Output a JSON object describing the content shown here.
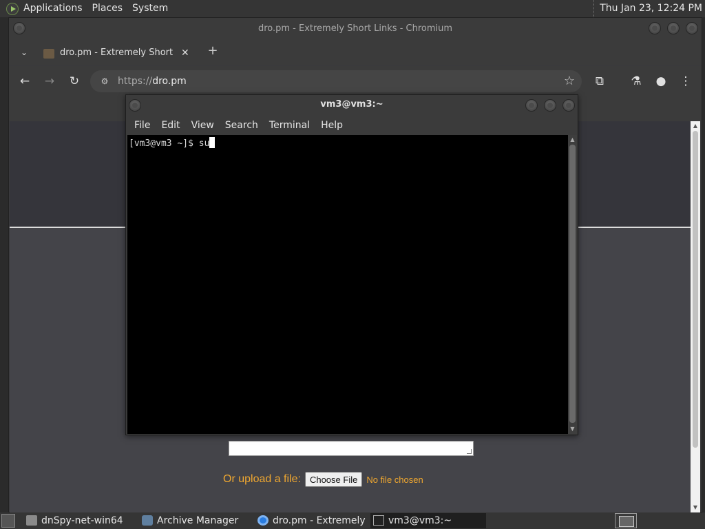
{
  "top_panel": {
    "menus": [
      "Applications",
      "Places",
      "System"
    ],
    "clock": "Thu Jan 23, 12:24 PM"
  },
  "browser": {
    "window_title": "dro.pm - Extremely Short Links - Chromium",
    "tab": {
      "title": "dro.pm - Extremely Short Links",
      "close_glyph": "✕"
    },
    "new_tab_glyph": "+",
    "tab_list_glyph": "⌄",
    "url_scheme": "https://",
    "url_host": "dro.pm",
    "buttons": {
      "back": "←",
      "forward": "→",
      "reload": "↻",
      "star": "☆",
      "extensions": "⧉",
      "labs": "⚗",
      "profile": "●",
      "menu": "⋮"
    }
  },
  "page": {
    "upload_label": "Or upload a file:",
    "choose_file": "Choose File",
    "no_file": "No file chosen"
  },
  "terminal": {
    "title": "vm3@vm3:~",
    "menus": [
      "File",
      "Edit",
      "View",
      "Search",
      "Terminal",
      "Help"
    ],
    "line": "[vm3@vm3 ~]$ su"
  },
  "taskbar": {
    "items": [
      {
        "label": "dnSpy-net-win64",
        "icon": "folder-icon"
      },
      {
        "label": "Archive Manager",
        "icon": "archive-icon"
      },
      {
        "label": "dro.pm - Extremely ...",
        "icon": "chromium-icon"
      },
      {
        "label": "vm3@vm3:~",
        "icon": "terminal-icon"
      }
    ]
  },
  "colors": {
    "accent_orange": "#f0a830",
    "panel_bg": "#353535",
    "page_bg": "#444449"
  }
}
